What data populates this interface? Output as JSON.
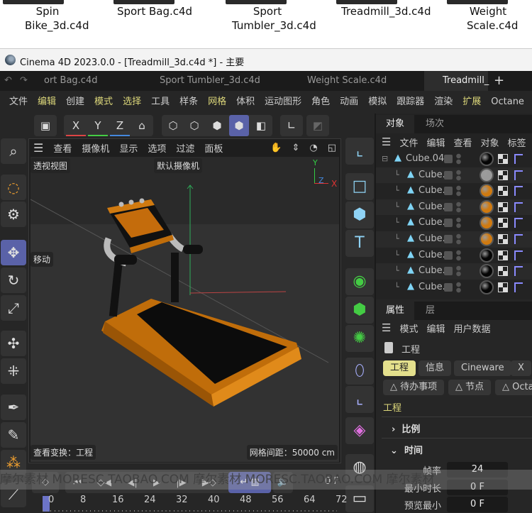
{
  "desktop_files": [
    "Spin Bike_3d.c4d",
    "Sport Bag.c4d",
    "Sport Tumbler_3d.c4d",
    "Treadmill_3d.c4d",
    "Weight Scale.c4d"
  ],
  "window_title": "Cinema 4D 2023.0.0 - [Treadmill_3d.c4d *] - 主要",
  "doc_tabs": [
    "ort Bag.c4d",
    "Sport Tumbler_3d.c4d",
    "Weight Scale.c4d",
    "Treadmill_"
  ],
  "new_tab": "+",
  "menu": [
    "文件",
    "编辑",
    "创建",
    "模式",
    "选择",
    "工具",
    "样条",
    "网格",
    "体积",
    "运动图形",
    "角色",
    "动画",
    "模拟",
    "跟踪器",
    "渲染",
    "扩展",
    "Octane"
  ],
  "toolbar": {
    "x": "X",
    "y": "Y",
    "z": "Z"
  },
  "viewport": {
    "menu": [
      "查看",
      "摄像机",
      "显示",
      "选项",
      "过滤",
      "面板"
    ],
    "view_name": "透视视图",
    "camera": "默认摄像机",
    "tool_label": "移动",
    "transform_label": "查看变换：工程",
    "grid_spacing": "网格间距：50000 cm",
    "axis": {
      "x": "X",
      "y": "Y",
      "z": "Z"
    }
  },
  "object_panel": {
    "tabs": [
      "对象",
      "场次"
    ],
    "menu": [
      "文件",
      "编辑",
      "查看",
      "对象",
      "标签"
    ],
    "objects": [
      {
        "name": "Cube.04",
        "material": "#050505"
      },
      {
        "name": "Cube.",
        "material": "#9a9a9a"
      },
      {
        "name": "Cube.",
        "material": "#d07a10"
      },
      {
        "name": "Cube.",
        "material": "#d07a10"
      },
      {
        "name": "Cube.",
        "material": "#d07a10"
      },
      {
        "name": "Cube.",
        "material": "#d07a10"
      },
      {
        "name": "Cube.",
        "material": "#050505"
      },
      {
        "name": "Cube.",
        "material": "#050505"
      },
      {
        "name": "Cube.",
        "material": "#050505"
      }
    ]
  },
  "attributes": {
    "tabs": [
      "属性",
      "层"
    ],
    "menu": [
      "模式",
      "编辑",
      "用户数据"
    ],
    "title": "工程",
    "chips_row1": [
      "工程",
      "信息",
      "Cineware",
      "X"
    ],
    "chips_row2": [
      "待办事项",
      "节点",
      "Octa"
    ],
    "section": "工程",
    "groups": [
      "比例",
      "时间"
    ],
    "fields": [
      {
        "label": "帧率",
        "value": "24"
      },
      {
        "label": "最小时长",
        "value": "0 F"
      },
      {
        "label": "预览最小",
        "value": "0 F"
      }
    ]
  },
  "timeline": {
    "current_frame": "0 F",
    "ticks": [
      "0",
      "8",
      "16",
      "24",
      "32",
      "40",
      "48",
      "56",
      "64",
      "72"
    ]
  },
  "watermark": "摩尔素材 MORESC.TAOBAO.COM   摩尔素材 MORESC.TAOBAO.COM   摩尔素材"
}
